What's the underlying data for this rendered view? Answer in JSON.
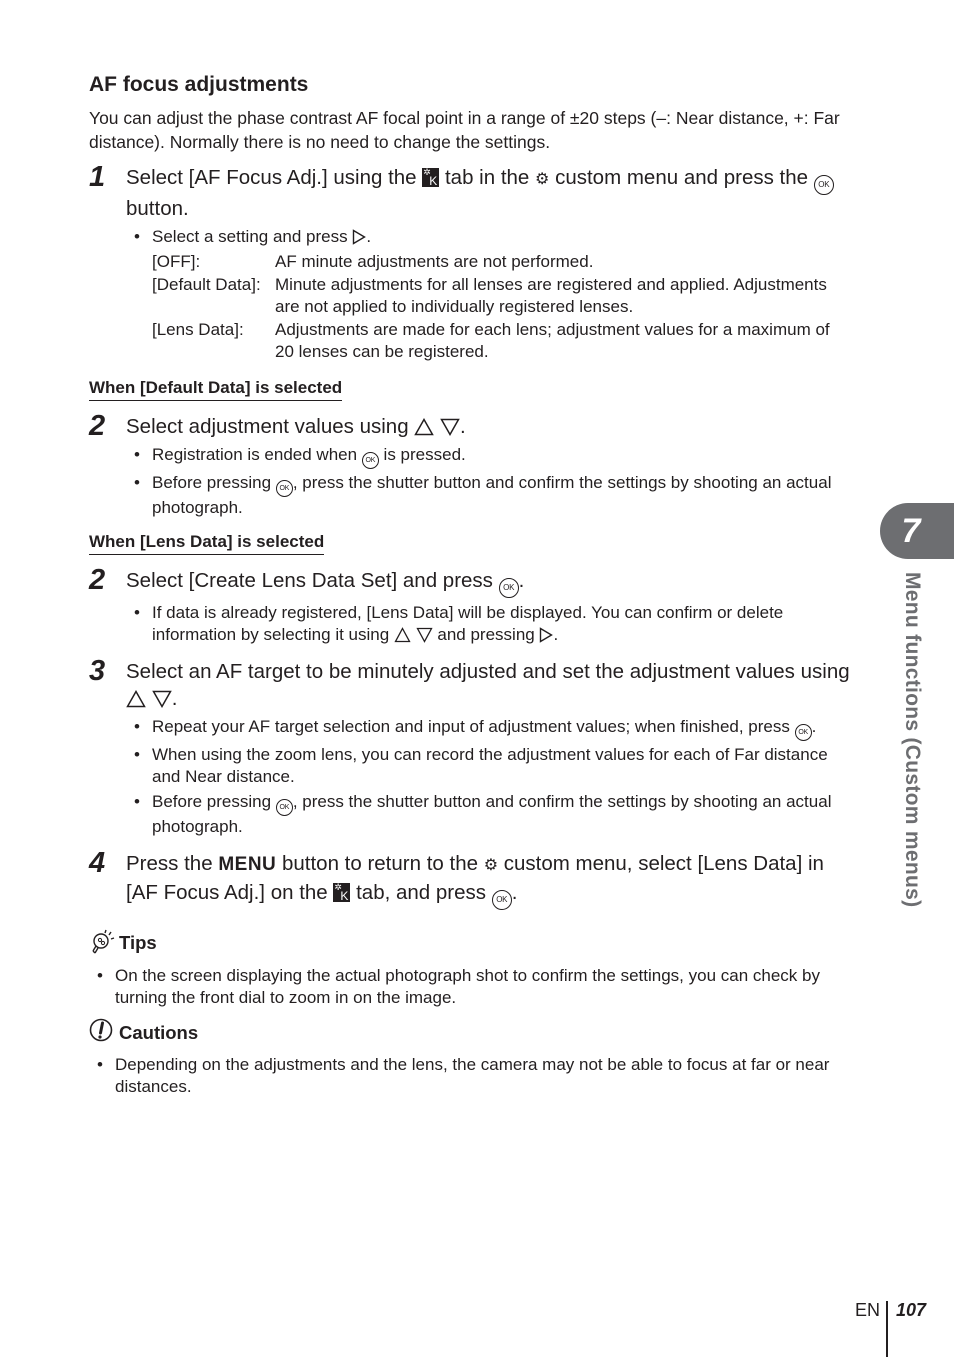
{
  "section": {
    "title": "AF focus adjustments",
    "intro": "You can adjust the phase contrast AF focal point in a range of ±20 steps (–: Near distance, +: Far distance). Normally there is no need to change the settings."
  },
  "icons": {
    "ok_label": "OK",
    "tab_letter": "K",
    "gear_glyph": "⚙"
  },
  "step1": {
    "number": "1",
    "text_a": "Select [AF Focus Adj.] using the",
    "text_b": "tab in the",
    "text_c": "custom menu and press the",
    "text_d": "button.",
    "bullet_a": "Select a setting and press",
    "bullet_b": ".",
    "options": [
      {
        "term": "[OFF]:",
        "desc": "AF minute adjustments are not performed."
      },
      {
        "term": "[Default Data]:",
        "desc": "Minute adjustments for all lenses are registered and applied. Adjustments are not applied to individually registered lenses."
      },
      {
        "term": "[Lens Data]:",
        "desc": "Adjustments are made for each lens; adjustment values for a maximum of 20 lenses can be registered."
      }
    ]
  },
  "default_data": {
    "heading": "When [Default Data] is selected",
    "step2": {
      "number": "2",
      "text_a": "Select adjustment values using",
      "text_b": ".",
      "bullets": [
        {
          "a": "Registration is ended when",
          "b": "is pressed."
        },
        {
          "a": "Before pressing",
          "b": ", press the shutter button and confirm the settings by shooting an actual photograph."
        }
      ]
    }
  },
  "lens_data": {
    "heading": "When [Lens Data] is selected",
    "step2": {
      "number": "2",
      "text_a": "Select [Create Lens Data Set] and press",
      "text_b": ".",
      "bullet_a": "If data is already registered, [Lens Data] will be displayed. You can confirm or delete information by selecting it using",
      "bullet_b": "and pressing",
      "bullet_c": "."
    },
    "step3": {
      "number": "3",
      "text_a": "Select an AF target to be minutely adjusted and set the adjustment values using",
      "text_b": ".",
      "bullets": [
        {
          "a": "Repeat your AF target selection and input of adjustment values; when finished, press",
          "b": "."
        },
        {
          "a": "When using the zoom lens, you can record the adjustment values for each of Far distance and Near distance."
        },
        {
          "a": "Before pressing",
          "b": ", press the shutter button and confirm the settings by shooting an actual photograph."
        }
      ]
    },
    "step4": {
      "number": "4",
      "text_a": "Press the",
      "menu_word": "MENU",
      "text_b": "button to return to the",
      "text_c": "custom menu, select [Lens Data] in [AF Focus Adj.] on the",
      "text_d": "tab, and press",
      "text_e": "."
    }
  },
  "tips": {
    "title": "Tips",
    "items": [
      "On the screen displaying the actual photograph shot to confirm the settings, you can check by turning the front dial to zoom in on the image."
    ]
  },
  "cautions": {
    "title": "Cautions",
    "items": [
      "Depending on the adjustments and the lens, the camera may not be able to focus at far or near distances."
    ]
  },
  "chapter": {
    "number": "7",
    "label": "Menu functions (Custom menus)"
  },
  "footer": {
    "lang": "EN",
    "page": "107"
  }
}
